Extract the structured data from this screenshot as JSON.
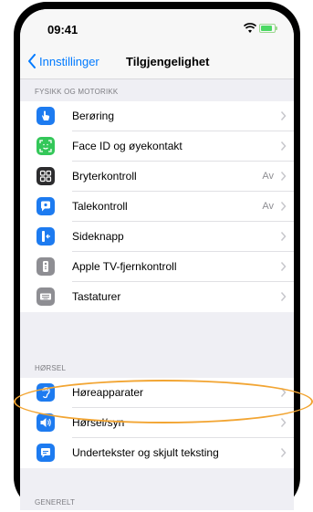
{
  "status": {
    "time": "09:41"
  },
  "nav": {
    "back_label": "Innstillinger",
    "title": "Tilgjengelighet"
  },
  "sections": [
    {
      "header": "FYSIKK OG MOTORIKK",
      "items": [
        {
          "label": "Berøring",
          "value": "",
          "icon": "hand-icon",
          "color": "#1d7bf0"
        },
        {
          "label": "Face ID og øyekontakt",
          "value": "",
          "icon": "face-id-icon",
          "color": "#34c759"
        },
        {
          "label": "Bryterkontroll",
          "value": "Av",
          "icon": "switch-control-icon",
          "color": "#2c2c2e"
        },
        {
          "label": "Talekontroll",
          "value": "Av",
          "icon": "voice-control-icon",
          "color": "#1d7bf0"
        },
        {
          "label": "Sideknapp",
          "value": "",
          "icon": "side-button-icon",
          "color": "#1d7bf0"
        },
        {
          "label": "Apple TV-fjernkontroll",
          "value": "",
          "icon": "remote-icon",
          "color": "#8e8e93"
        },
        {
          "label": "Tastaturer",
          "value": "",
          "icon": "keyboard-icon",
          "color": "#8e8e93"
        }
      ]
    },
    {
      "header": "HØRSEL",
      "items": [
        {
          "label": "Høreapparater",
          "value": "",
          "icon": "ear-icon",
          "color": "#1d7bf0"
        },
        {
          "label": "Hørsel/syn",
          "value": "",
          "icon": "speaker-icon",
          "color": "#1d7bf0"
        },
        {
          "label": "Undertekster og skjult teksting",
          "value": "",
          "icon": "subtitles-icon",
          "color": "#1d7bf0"
        }
      ]
    },
    {
      "header": "GENERELT",
      "items": []
    }
  ],
  "colors": {
    "accent": "#007aff",
    "highlight": "#f2a533"
  }
}
